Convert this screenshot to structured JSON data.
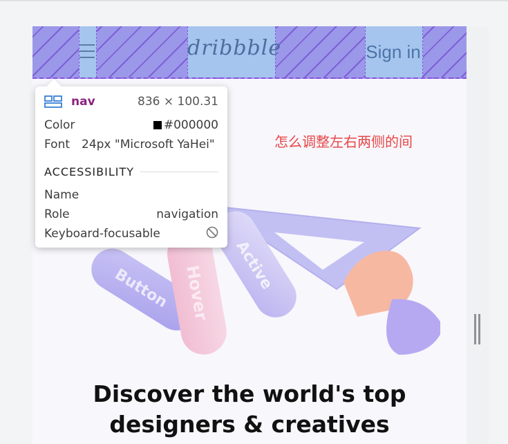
{
  "nav": {
    "logo": "dribbble",
    "signin": "Sign in",
    "menu_icon": "hamburger-menu-icon"
  },
  "inspector": {
    "tag": "nav",
    "size": "836 × 100.31",
    "color_label": "Color",
    "color_value": "#000000",
    "font_label": "Font",
    "font_value": "24px \"Microsoft YaHei\"",
    "section": "ACCESSIBILITY",
    "name_label": "Name",
    "role_label": "Role",
    "role_value": "navigation",
    "focus_label": "Keyboard-focusable",
    "icon": "layout-grid-icon",
    "focus_icon": "not-allowed-icon"
  },
  "hero": {
    "pills": [
      "Button",
      "Hover",
      "Active"
    ]
  },
  "note": "怎么调整左右两侧的间",
  "headline": {
    "line1": "Discover the world's top",
    "line2": "designers & creatives"
  },
  "colors": {
    "nav_overlay": "#9b98e9",
    "nav_cell": "#a6c5ee",
    "note": "#e84747",
    "tag": "#8a237f"
  }
}
